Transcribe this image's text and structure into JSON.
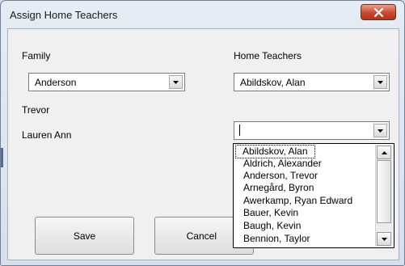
{
  "window": {
    "title": "Assign Home Teachers"
  },
  "family": {
    "label": "Family",
    "value": "Anderson",
    "members": [
      "Trevor",
      "Lauren Ann"
    ]
  },
  "home_teachers": {
    "label": "Home Teachers",
    "companion_1": "Abildskov, Alan",
    "companion_2": ""
  },
  "dropdown_list": {
    "items": [
      "Abildskov, Alan",
      "Aldrich, Alexander",
      "Anderson, Trevor",
      "Arnegård, Byron",
      "Awerkamp, Ryan Edward",
      "Bauer, Kevin",
      "Baugh, Kevin",
      "Bennion, Taylor"
    ],
    "selected_index": 0
  },
  "buttons": {
    "save": "Save",
    "cancel": "Cancel"
  },
  "icons": {
    "close": "close-icon",
    "dropdown": "chevron-down-icon",
    "scroll_up": "scroll-up-arrow-icon",
    "scroll_down": "scroll-down-arrow-icon"
  },
  "colors": {
    "close_button": "#c9482f",
    "title_bar": "#dbe4ef"
  }
}
